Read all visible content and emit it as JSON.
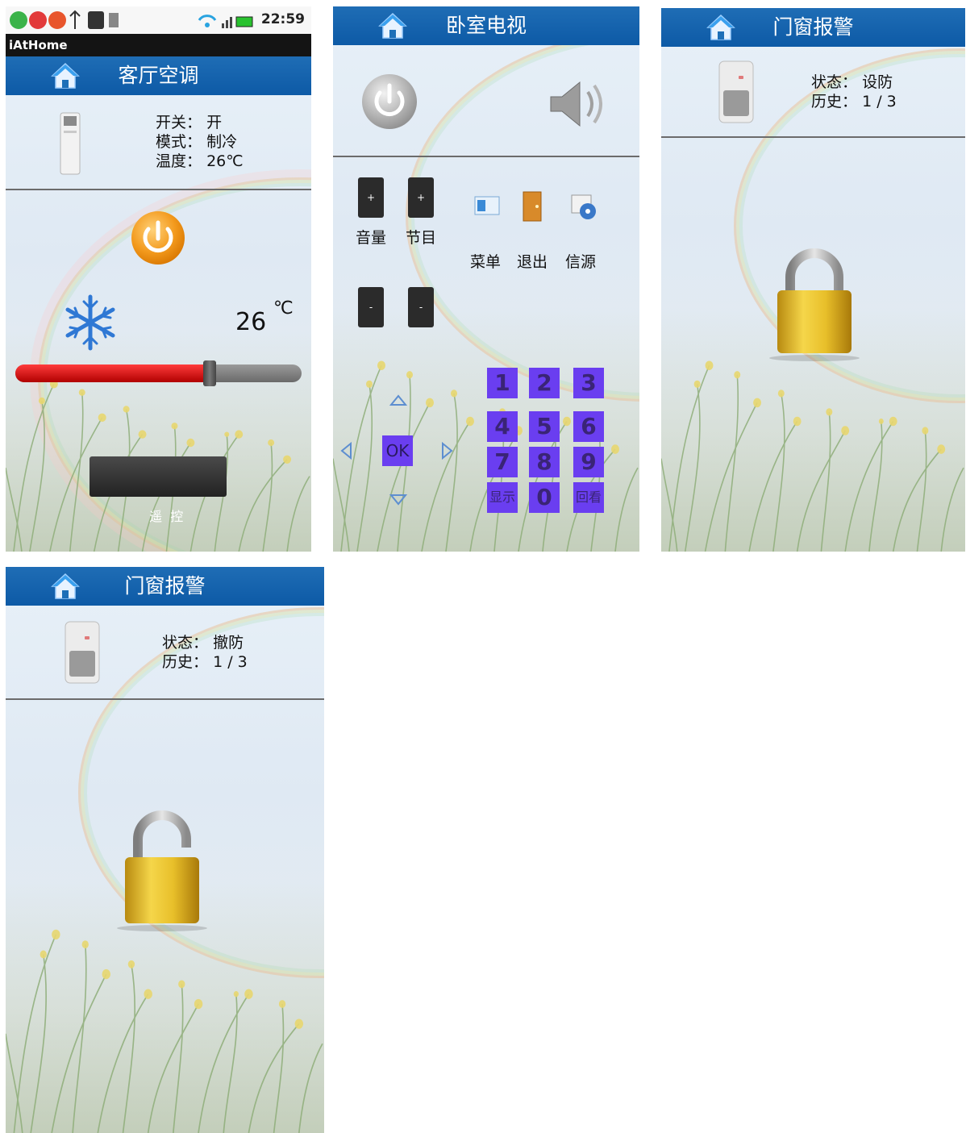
{
  "statusbar": {
    "app_name": "iAtHome",
    "time": "22:59"
  },
  "ac": {
    "title": "客厅空调",
    "switch_label": "开关：",
    "switch_value": "开",
    "mode_label": "模式：",
    "mode_value": "制冷",
    "temp_label": "温度：",
    "temp_value": "26℃",
    "set_temp": "26",
    "temp_unit": "℃",
    "slider_level": 0.68,
    "remote_button": "遥  控"
  },
  "tv": {
    "title": "卧室电视",
    "plus": "+",
    "minus": "-",
    "volume": "音量",
    "channel": "节目",
    "menu": "菜单",
    "exit": "退出",
    "source": "信源",
    "ok": "OK",
    "keys": [
      "1",
      "2",
      "3",
      "4",
      "5",
      "6",
      "7",
      "8",
      "9",
      "显示",
      "0",
      "回看"
    ]
  },
  "alarm_armed": {
    "title": "门窗报警",
    "status_label": "状态：",
    "status_value": "设防",
    "history_label": "历史：",
    "history_value": "1 / 3"
  },
  "alarm_disarmed": {
    "title": "门窗报警",
    "status_label": "状态：",
    "status_value": "撤防",
    "history_label": "历史：",
    "history_value": "1 / 3"
  },
  "colors": {
    "titlebar": "#0d5aa6",
    "slider_fill": "#d90000",
    "power_orange": "#f39a1d",
    "keypad": "#6a3ef0"
  }
}
